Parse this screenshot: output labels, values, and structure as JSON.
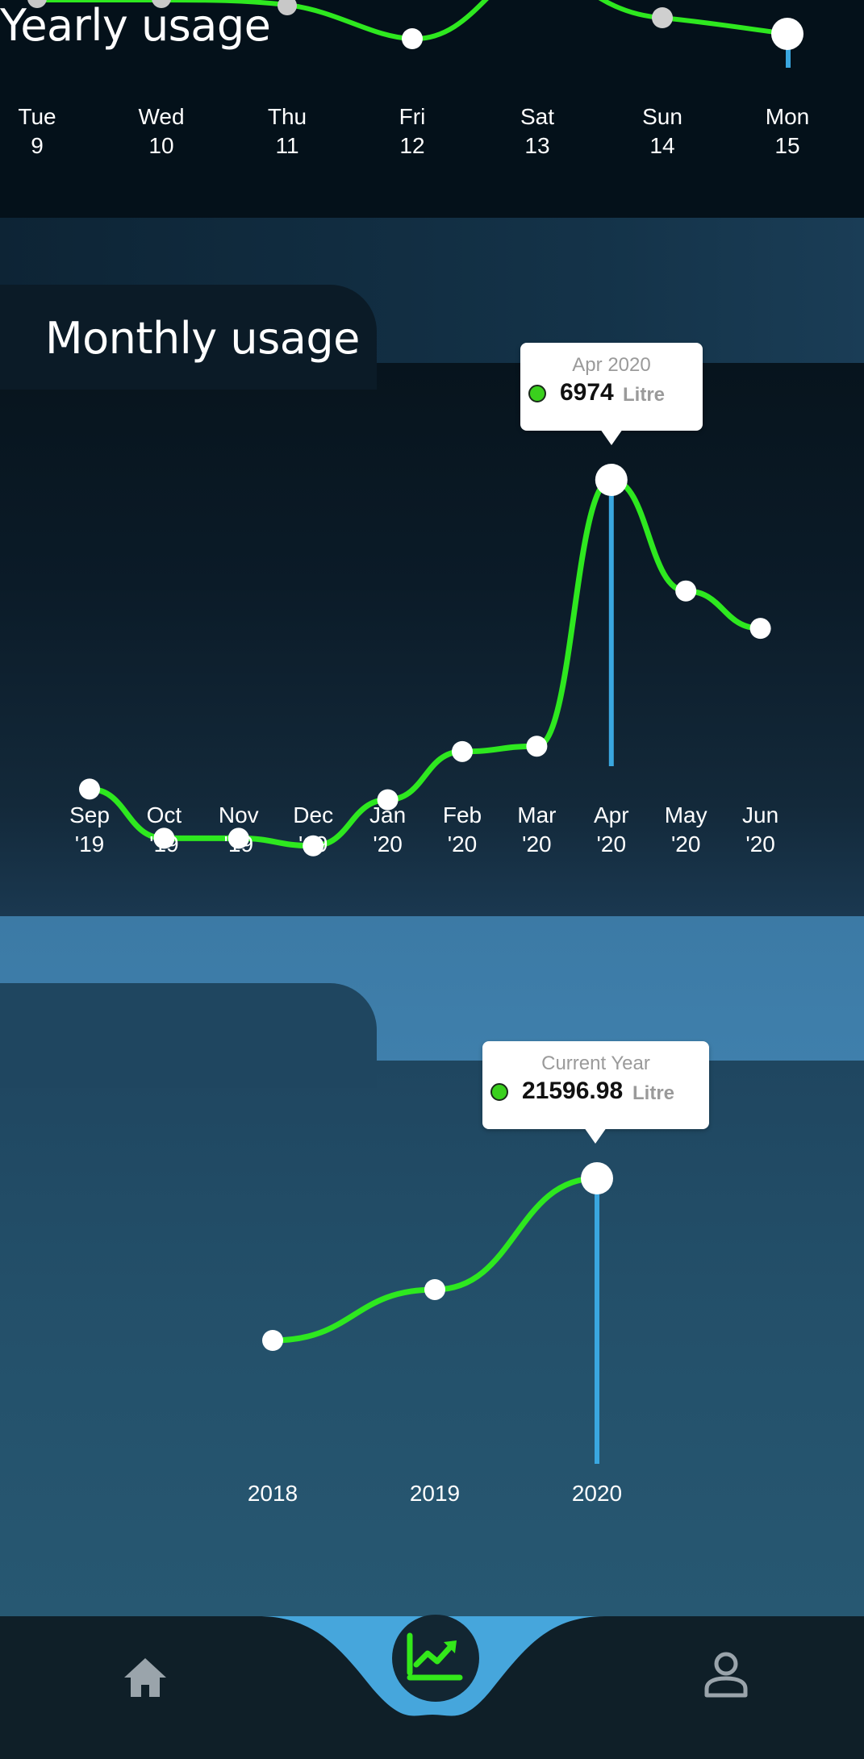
{
  "daily": {
    "days": [
      {
        "name": "Tue",
        "num": "9"
      },
      {
        "name": "Wed",
        "num": "10"
      },
      {
        "name": "Thu",
        "num": "11"
      },
      {
        "name": "Fri",
        "num": "12"
      },
      {
        "name": "Sat",
        "num": "13"
      },
      {
        "name": "Sun",
        "num": "14"
      },
      {
        "name": "Mon",
        "num": "15"
      }
    ]
  },
  "monthly": {
    "title": "Monthly usage",
    "tooltip": {
      "period": "Apr 2020",
      "value": "6974",
      "unit": "Litre"
    }
  },
  "yearly": {
    "title": "Yearly usage",
    "tooltip": {
      "period": "Current Year",
      "value": "21596.98",
      "unit": "Litre"
    }
  },
  "chart_data": [
    {
      "type": "line",
      "title": "Monthly usage",
      "categories": [
        "Sep '19",
        "Oct '19",
        "Nov '19",
        "Dec '19",
        "Jan '20",
        "Feb '20",
        "Mar '20",
        "Apr '20",
        "May '20",
        "Jun '20"
      ],
      "category_lines": [
        [
          "Sep",
          "'19"
        ],
        [
          "Oct",
          "'19"
        ],
        [
          "Nov",
          "'19"
        ],
        [
          "Dec",
          "'19"
        ],
        [
          "Jan",
          "'20"
        ],
        [
          "Feb",
          "'20"
        ],
        [
          "Mar",
          "'20"
        ],
        [
          "Apr",
          "'20"
        ],
        [
          "May",
          "'20"
        ],
        [
          "Jun",
          "'20"
        ]
      ],
      "values": [
        1200,
        280,
        280,
        140,
        1000,
        1900,
        2000,
        6974,
        4900,
        4200
      ],
      "highlight_index": 7,
      "series_color": "#2ee81f",
      "highlight_line_color": "#3aa7e0",
      "unit": "Litre"
    },
    {
      "type": "line",
      "title": "Yearly usage",
      "categories": [
        "2018",
        "2019",
        "2020"
      ],
      "values": [
        1500,
        7800,
        21596.98
      ],
      "highlight_index": 2,
      "series_color": "#2ee81f",
      "highlight_line_color": "#3aa7e0",
      "unit": "Litre"
    }
  ],
  "nav": {
    "items": [
      {
        "icon": "home-icon"
      },
      {
        "icon": "chart-icon",
        "active": true
      },
      {
        "icon": "person-icon"
      }
    ],
    "accent": "#46a6dc",
    "active_icon_color": "#33e81a"
  }
}
